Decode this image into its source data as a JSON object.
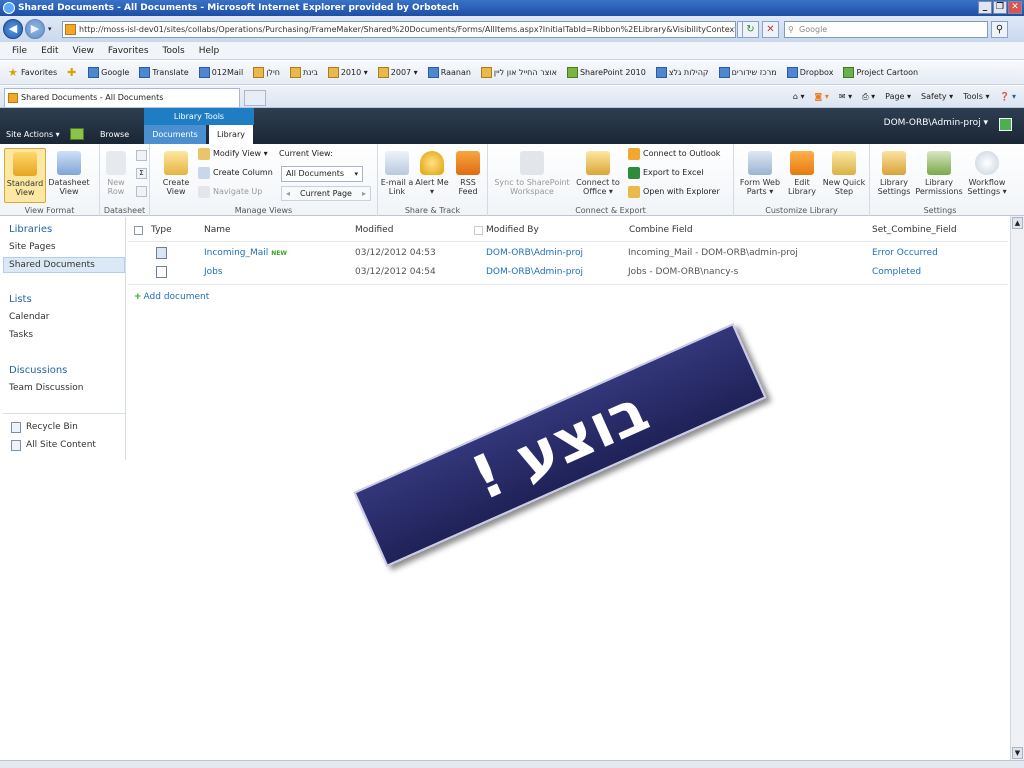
{
  "window": {
    "title": "Shared Documents - All Documents - Microsoft Internet Explorer provided by Orbotech",
    "buttons": [
      "_",
      "❐",
      "✕"
    ]
  },
  "address_bar": {
    "url": "http://moss-isl-dev01/sites/collabs/Operations/Purchasing/FrameMaker/Shared%20Documents/Forms/AllItems.aspx?InitialTabId=Ribbon%2ELibrary&VisibilityContext",
    "search_placeholder": "Google"
  },
  "menu": [
    "File",
    "Edit",
    "View",
    "Favorites",
    "Tools",
    "Help"
  ],
  "favorites_bar": {
    "favorites_label": "Favorites",
    "items": [
      "Google",
      "Translate",
      "012Mail",
      "חילן",
      "בינת",
      "2010 ▾",
      "2007 ▾",
      "Raanan",
      "אוצר החייל און ליין",
      "SharePoint 2010",
      "קהילות גלצ",
      "מרכז שידורים",
      "Dropbox",
      "Project Cartoon"
    ]
  },
  "browser_tab": {
    "title": "Shared Documents - All Documents",
    "commands": [
      "Page ▾",
      "Safety ▾",
      "Tools ▾"
    ]
  },
  "sharepoint": {
    "site_actions": "Site Actions ▾",
    "browse": "Browse",
    "library_tools": "Library Tools",
    "tab_documents": "Documents",
    "tab_library": "Library",
    "user": "DOM-ORB\\Admin-proj ▾"
  },
  "ribbon": {
    "view_format": {
      "label": "View Format",
      "standard_view": "Standard View",
      "datasheet_view": "Datasheet View"
    },
    "datasheet": {
      "label": "Datasheet",
      "new_row": "New Row"
    },
    "manage_views": {
      "label": "Manage Views",
      "create_view": "Create View",
      "modify_view": "Modify View ▾",
      "create_column": "Create Column",
      "navigate_up": "Navigate Up",
      "current_view_label": "Current View:",
      "current_view_value": "All Documents",
      "current_page": "Current Page"
    },
    "share_track": {
      "label": "Share & Track",
      "email_link": "E-mail a Link",
      "alert_me": "Alert Me ▾",
      "rss_feed": "RSS Feed"
    },
    "connect_export": {
      "label": "Connect & Export",
      "sync": "Sync to SharePoint Workspace",
      "connect_office": "Connect to Office ▾",
      "connect_outlook": "Connect to Outlook",
      "export_excel": "Export to Excel",
      "open_explorer": "Open with Explorer"
    },
    "customize_library": {
      "label": "Customize Library",
      "form_web_parts": "Form Web Parts ▾",
      "edit_library": "Edit Library",
      "new_quick_step": "New Quick Step"
    },
    "settings": {
      "label": "Settings",
      "library_settings": "Library Settings",
      "library_permissions": "Library Permissions",
      "workflow_settings": "Workflow Settings ▾"
    }
  },
  "left_nav": {
    "libraries": "Libraries",
    "site_pages": "Site Pages",
    "shared_documents": "Shared Documents",
    "lists": "Lists",
    "calendar": "Calendar",
    "tasks": "Tasks",
    "discussions": "Discussions",
    "team_discussion": "Team Discussion",
    "recycle_bin": "Recycle Bin",
    "all_site_content": "All Site Content"
  },
  "list": {
    "columns": [
      "Type",
      "Name",
      "Modified",
      "Modified By",
      "Combine Field",
      "Set_Combine_Field"
    ],
    "rows": [
      {
        "name": "Incoming_Mail",
        "badge": "NEW",
        "modified": "03/12/2012 04:53",
        "modified_by": "DOM-ORB\\Admin-proj",
        "combine": "Incoming_Mail - DOM-ORB\\admin-proj",
        "set_combine": "Error Occurred"
      },
      {
        "name": "Jobs",
        "modified": "03/12/2012 04:54",
        "modified_by": "DOM-ORB\\Admin-proj",
        "combine": "Jobs - DOM-ORB\\nancy-s",
        "set_combine": "Completed"
      }
    ],
    "add_document": "Add document"
  },
  "banner": {
    "text": "בוצע !"
  },
  "colors": {
    "sharepoint_band": "#1a2634",
    "ribbon_tab_blue": "#1f7ec3",
    "link": "#1f6fc0",
    "banner": "#2a2d6e"
  }
}
